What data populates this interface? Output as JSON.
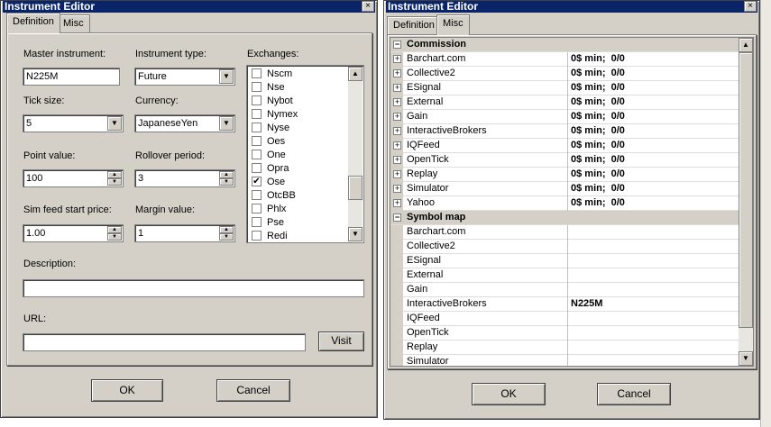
{
  "left_window": {
    "title": "Instrument Editor",
    "close_glyph": "×",
    "tabs": [
      "Definition",
      "Misc"
    ],
    "fields": {
      "master_instrument_label": "Master instrument:",
      "master_instrument_value": "N225M",
      "instrument_type_label": "Instrument type:",
      "instrument_type_value": "Future",
      "tick_size_label": "Tick size:",
      "tick_size_value": "5",
      "currency_label": "Currency:",
      "currency_value": "JapaneseYen",
      "point_value_label": "Point value:",
      "point_value_value": "100",
      "rollover_period_label": "Rollover period:",
      "rollover_period_value": "3",
      "sim_feed_label": "Sim feed start price:",
      "sim_feed_value": "1.00",
      "margin_value_label": "Margin value:",
      "margin_value_value": "1",
      "description_label": "Description:",
      "description_value": "",
      "url_label": "URL:",
      "url_value": ""
    },
    "exchanges_label": "Exchanges:",
    "exchanges": [
      {
        "name": "Nscm",
        "checked": false
      },
      {
        "name": "Nse",
        "checked": false
      },
      {
        "name": "Nybot",
        "checked": false
      },
      {
        "name": "Nymex",
        "checked": false
      },
      {
        "name": "Nyse",
        "checked": false
      },
      {
        "name": "Oes",
        "checked": false
      },
      {
        "name": "One",
        "checked": false
      },
      {
        "name": "Opra",
        "checked": false
      },
      {
        "name": "Ose",
        "checked": true
      },
      {
        "name": "OtcBB",
        "checked": false
      },
      {
        "name": "Phlx",
        "checked": false
      },
      {
        "name": "Pse",
        "checked": false
      },
      {
        "name": "Redi",
        "checked": false
      }
    ],
    "visit_label": "Visit",
    "ok_label": "OK",
    "cancel_label": "Cancel"
  },
  "right_window": {
    "title": "Instrument Editor",
    "close_glyph": "×",
    "tabs": [
      "Definition",
      "Misc"
    ],
    "commission_label": "Commission",
    "commission_rows": [
      {
        "name": "Barchart.com",
        "value": "0$ min;  0/0"
      },
      {
        "name": "Collective2",
        "value": "0$ min;  0/0"
      },
      {
        "name": "ESignal",
        "value": "0$ min;  0/0"
      },
      {
        "name": "External",
        "value": "0$ min;  0/0"
      },
      {
        "name": "Gain",
        "value": "0$ min;  0/0"
      },
      {
        "name": "InteractiveBrokers",
        "value": "0$ min;  0/0"
      },
      {
        "name": "IQFeed",
        "value": "0$ min;  0/0"
      },
      {
        "name": "OpenTick",
        "value": "0$ min;  0/0"
      },
      {
        "name": "Replay",
        "value": "0$ min;  0/0"
      },
      {
        "name": "Simulator",
        "value": "0$ min;  0/0"
      },
      {
        "name": "Yahoo",
        "value": "0$ min;  0/0"
      }
    ],
    "symbol_map_label": "Symbol map",
    "symbol_rows": [
      {
        "name": "Barchart.com",
        "value": ""
      },
      {
        "name": "Collective2",
        "value": ""
      },
      {
        "name": "ESignal",
        "value": ""
      },
      {
        "name": "External",
        "value": ""
      },
      {
        "name": "Gain",
        "value": ""
      },
      {
        "name": "InteractiveBrokers",
        "value": "N225M"
      },
      {
        "name": "IQFeed",
        "value": ""
      },
      {
        "name": "OpenTick",
        "value": ""
      },
      {
        "name": "Replay",
        "value": ""
      },
      {
        "name": "Simulator",
        "value": ""
      }
    ],
    "ok_label": "OK",
    "cancel_label": "Cancel"
  }
}
